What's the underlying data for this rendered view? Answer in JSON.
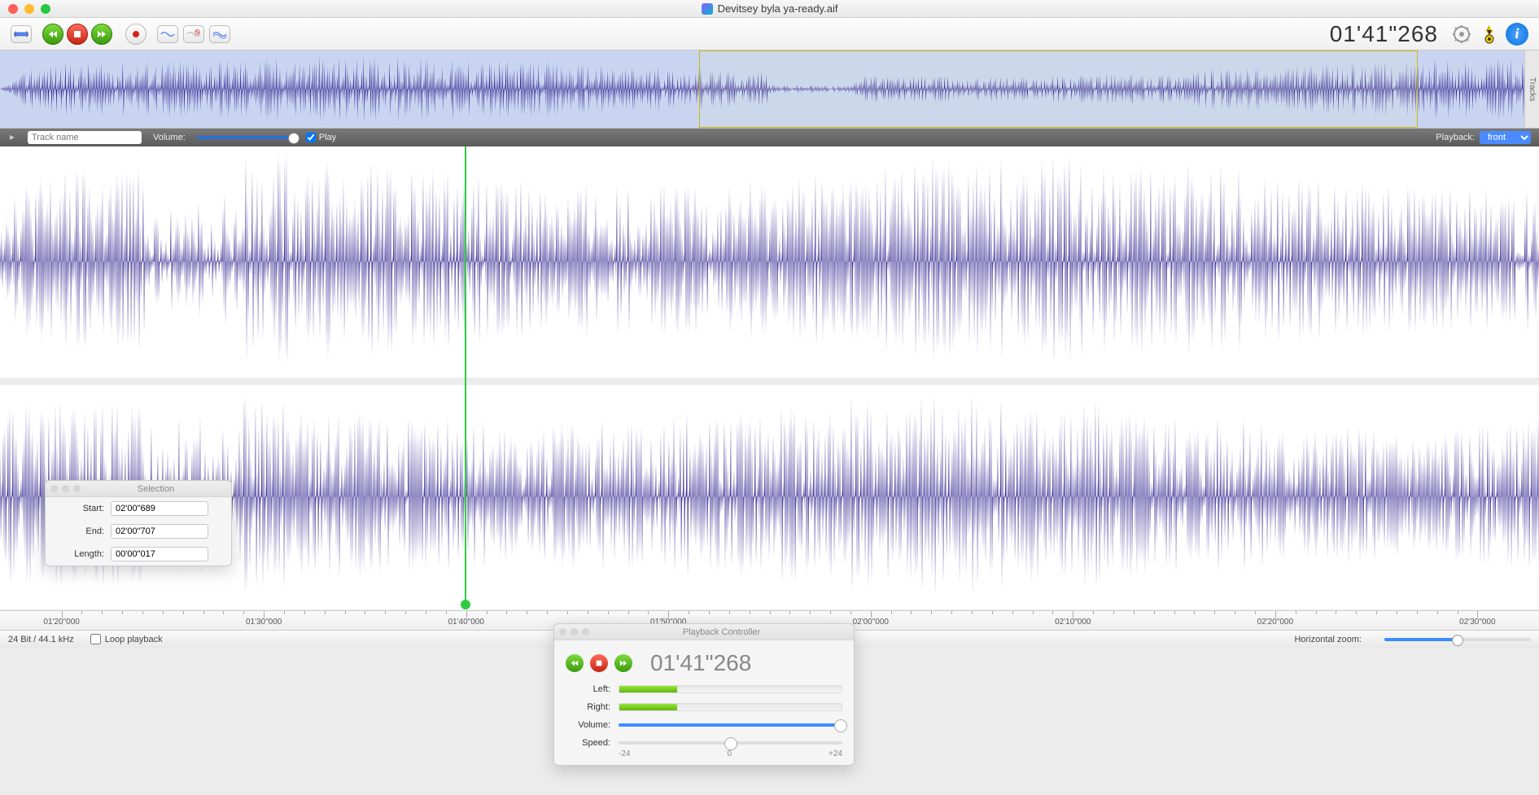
{
  "window": {
    "title": "Devitsey byla ya-ready.aif"
  },
  "toolbar": {
    "time": "01'41\"268"
  },
  "tracks_label": "Tracks",
  "track_header": {
    "name_placeholder": "Track name",
    "volume_label": "Volume:",
    "play_label": "Play",
    "playback_label": "Playback:",
    "playback_value": "front"
  },
  "ruler": {
    "labels": [
      "01'20\"000",
      "01'30\"000",
      "01'40\"000",
      "01'50\"000",
      "02'00\"000",
      "02'10\"000",
      "02'20\"000",
      "02'30\"000"
    ]
  },
  "status": {
    "format": "24 Bit / 44.1 kHz",
    "loop_label": "Loop playback",
    "hz_label": "Horizontal zoom:"
  },
  "selection_panel": {
    "title": "Selection",
    "start_label": "Start:",
    "start_value": "02'00\"689",
    "end_label": "End:",
    "end_value": "02'00\"707",
    "length_label": "Length:",
    "length_value": "00'00\"017"
  },
  "playback_panel": {
    "title": "Playback Controller",
    "time": "01'41\"268",
    "left_label": "Left:",
    "right_label": "Right:",
    "volume_label": "Volume:",
    "speed_label": "Speed:",
    "tick_neg": "-24",
    "tick_zero": "0",
    "tick_pos": "+24"
  }
}
